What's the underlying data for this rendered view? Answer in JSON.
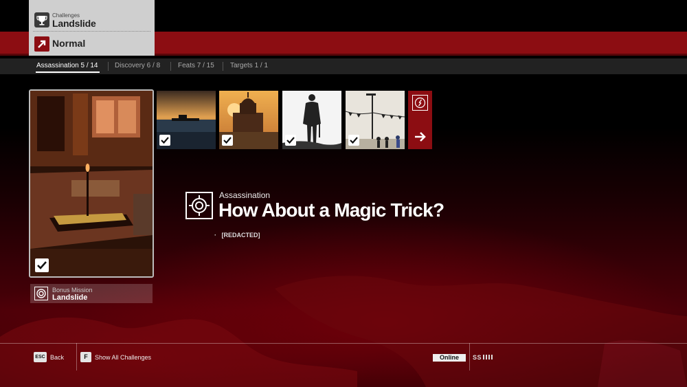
{
  "header": {
    "category_small": "Challenges",
    "category_title": "Landslide",
    "difficulty": "Normal",
    "icons": {
      "category": "trophy-icon",
      "difficulty": "arrow-up-right-icon"
    }
  },
  "tabs": [
    {
      "label": "Assassination 5 / 14",
      "active": true
    },
    {
      "label": "Discovery 6 / 8",
      "active": false
    },
    {
      "label": "Feats 7 / 15",
      "active": false
    },
    {
      "label": "Targets 1 / 1",
      "active": false
    }
  ],
  "selected_challenge": {
    "completed": true,
    "mission_small": "Bonus Mission",
    "mission_title": "Landslide"
  },
  "thumbnails": [
    {
      "scene": "sunset-sea-boats",
      "completed": true
    },
    {
      "scene": "church-tower-sunset",
      "completed": true
    },
    {
      "scene": "agent-silhouette",
      "completed": true
    },
    {
      "scene": "pennants-crowd",
      "completed": true
    }
  ],
  "next_tile": {
    "icon": "compass-icon",
    "arrow": "arrow-right-icon"
  },
  "detail": {
    "category": "Assassination",
    "title": "How About a Magic Trick?",
    "bullet": "[REDACTED]",
    "icon": "crosshair-icon"
  },
  "footer": {
    "back_key": "ESC",
    "back_label": "Back",
    "show_all_key": "F",
    "show_all_label": "Show All Challenges",
    "status": "Online",
    "signal": "SS"
  },
  "colors": {
    "accent": "#8c0d12",
    "panel": "#cfcfcf",
    "bar": "#222222"
  }
}
